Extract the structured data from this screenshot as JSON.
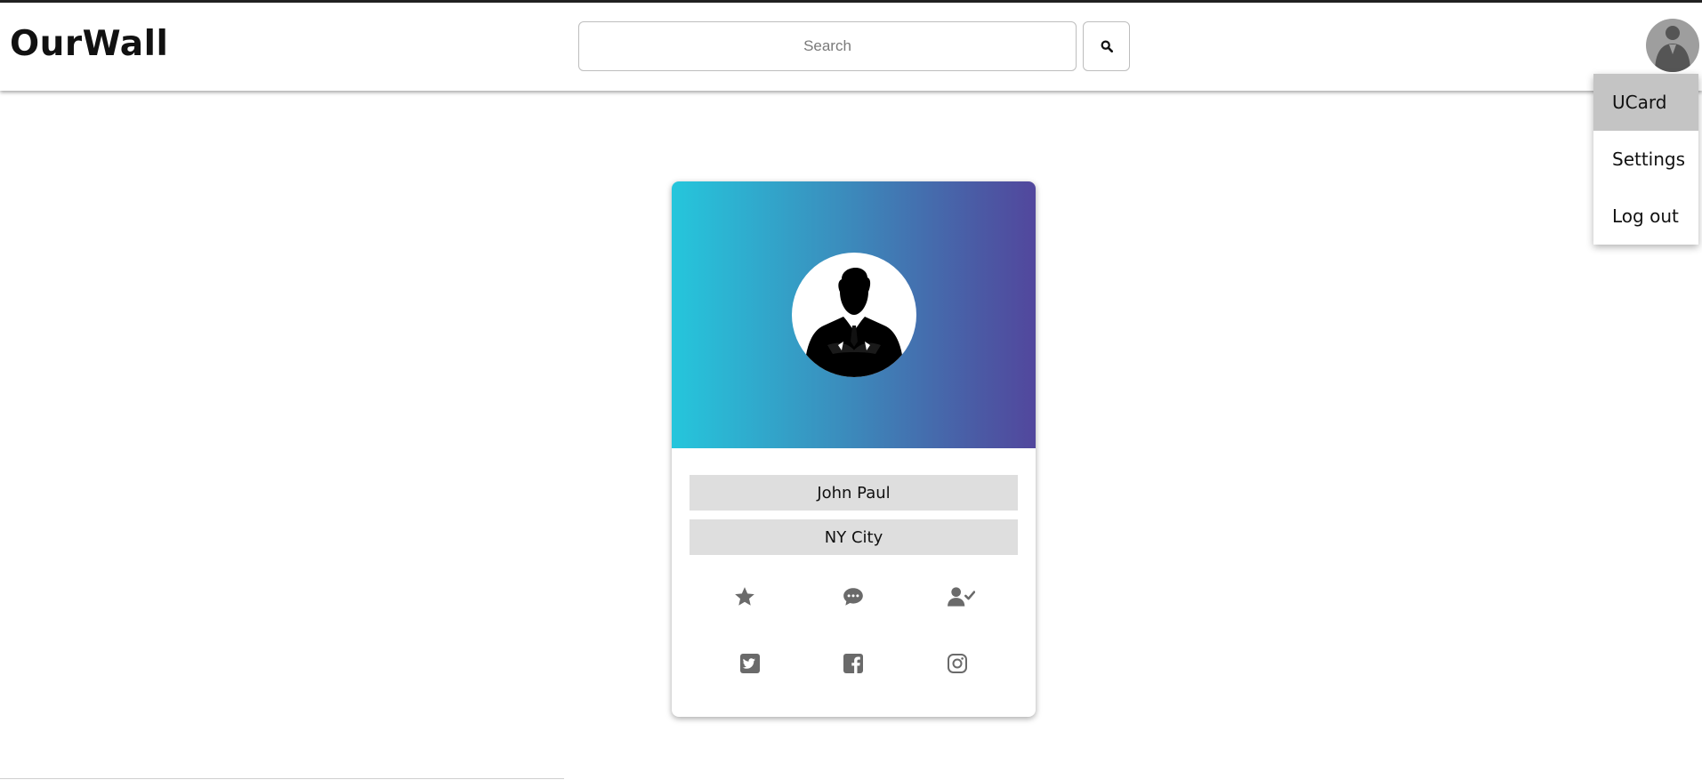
{
  "header": {
    "brand": "OurWall",
    "search_placeholder": "Search",
    "search_icon": "search-icon",
    "avatar_icon": "user-avatar-icon"
  },
  "dropdown": {
    "items": [
      {
        "label": "UCard",
        "active": true
      },
      {
        "label": "Settings",
        "active": false
      },
      {
        "label": "Log out",
        "active": false
      }
    ]
  },
  "card": {
    "banner_colors": [
      "#25c6dc",
      "#52479d"
    ],
    "avatar_icon": "profile-silhouette-icon",
    "name": "John Paul",
    "city": "NY City",
    "action_icons": [
      "star-icon",
      "chat-icon",
      "user-check-icon"
    ],
    "social_icons": [
      "twitter-icon",
      "facebook-icon",
      "instagram-icon"
    ],
    "icon_color": "#6a6a6a"
  }
}
